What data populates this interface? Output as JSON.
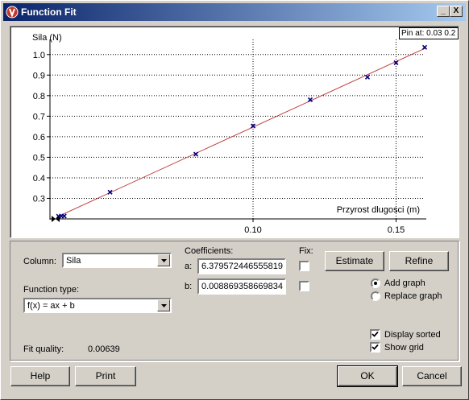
{
  "window": {
    "title": "Function Fit",
    "minimize": "_",
    "maximize": "□",
    "close": "X"
  },
  "plot": {
    "pin_text": "Pin at: 0.03 0.2",
    "ylabel": "Sila (N)",
    "xlabel": "Przyrost dlugosci (m)",
    "y_ticks": [
      "1.0",
      "0.9",
      "0.8",
      "0.7",
      "0.6",
      "0.5",
      "0.4",
      "0.3"
    ],
    "x_ticks": [
      "0.10",
      "0.15"
    ]
  },
  "chart_data": {
    "type": "scatter",
    "xlabel": "Przyrost dlugosci (m)",
    "ylabel": "Sila (N)",
    "xlim": [
      0.029,
      0.16
    ],
    "ylim": [
      0.2,
      1.05
    ],
    "x_ticks": [
      0.1,
      0.15
    ],
    "y_ticks": [
      0.3,
      0.4,
      0.5,
      0.6,
      0.7,
      0.8,
      0.9,
      1.0
    ],
    "grid": true,
    "series": [
      {
        "points": [
          [
            0.032,
            0.213
          ],
          [
            0.033,
            0.214
          ],
          [
            0.034,
            0.214
          ],
          [
            0.05,
            0.33
          ],
          [
            0.08,
            0.515
          ],
          [
            0.1,
            0.652
          ],
          [
            0.12,
            0.78
          ],
          [
            0.14,
            0.89
          ],
          [
            0.15,
            0.96
          ],
          [
            0.16,
            1.035
          ]
        ]
      }
    ],
    "fit_line": {
      "a": 6.379572446555819,
      "b": 0.008869358669834,
      "color": "#c04040"
    },
    "marker_color": "#000080"
  },
  "controls": {
    "column_label": "Column:",
    "column_value": "Sila",
    "function_type_label": "Function type:",
    "function_type_value": "f(x) = ax + b",
    "coefficients_label": "Coefficients:",
    "fix_label": "Fix:",
    "coef_a_label": "a:",
    "coef_a_value": "6.379572446555819",
    "coef_b_label": "b:",
    "coef_b_value": "0.008869358669834",
    "fix_a_checked": false,
    "fix_b_checked": false,
    "estimate_label": "Estimate",
    "refine_label": "Refine",
    "add_graph_label": "Add graph",
    "replace_graph_label": "Replace graph",
    "add_graph_selected": true,
    "display_sorted_label": "Display sorted",
    "display_sorted_checked": true,
    "show_grid_label": "Show grid",
    "show_grid_checked": true,
    "fit_quality_label": "Fit quality:",
    "fit_quality_value": "0.00639"
  },
  "buttons": {
    "help": "Help",
    "print": "Print",
    "ok": "OK",
    "cancel": "Cancel"
  }
}
